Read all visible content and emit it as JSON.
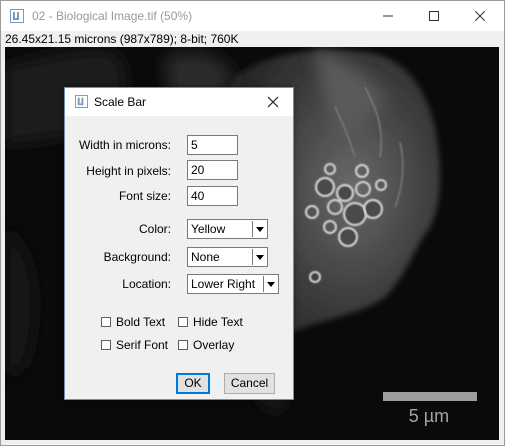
{
  "window": {
    "title": "02 - Biological Image.tif (50%)",
    "info": "26.45x21.15 microns (987x789); 8-bit; 760K"
  },
  "image": {
    "scale_bar_label": "5 µm",
    "scale_bar_color": "#9e9e9e"
  },
  "dialog": {
    "title": "Scale Bar",
    "fields": {
      "width_label": "Width in microns:",
      "width_value": "5",
      "height_label": "Height in pixels:",
      "height_value": "20",
      "font_label": "Font size:",
      "font_value": "40"
    },
    "selects": {
      "color_label": "Color:",
      "color_value": "Yellow",
      "background_label": "Background:",
      "background_value": "None",
      "location_label": "Location:",
      "location_value": "Lower Right"
    },
    "checkboxes": {
      "bold_text": "Bold Text",
      "hide_text": "Hide Text",
      "serif_font": "Serif Font",
      "overlay": "Overlay"
    },
    "buttons": {
      "ok": "OK",
      "cancel": "Cancel"
    }
  },
  "colors": {
    "accent": "#0078d7",
    "image_background": "#0a0a0a"
  },
  "icons": [
    "imagej-icon",
    "minimize-icon",
    "maximize-icon",
    "close-icon",
    "chevron-down-icon"
  ]
}
